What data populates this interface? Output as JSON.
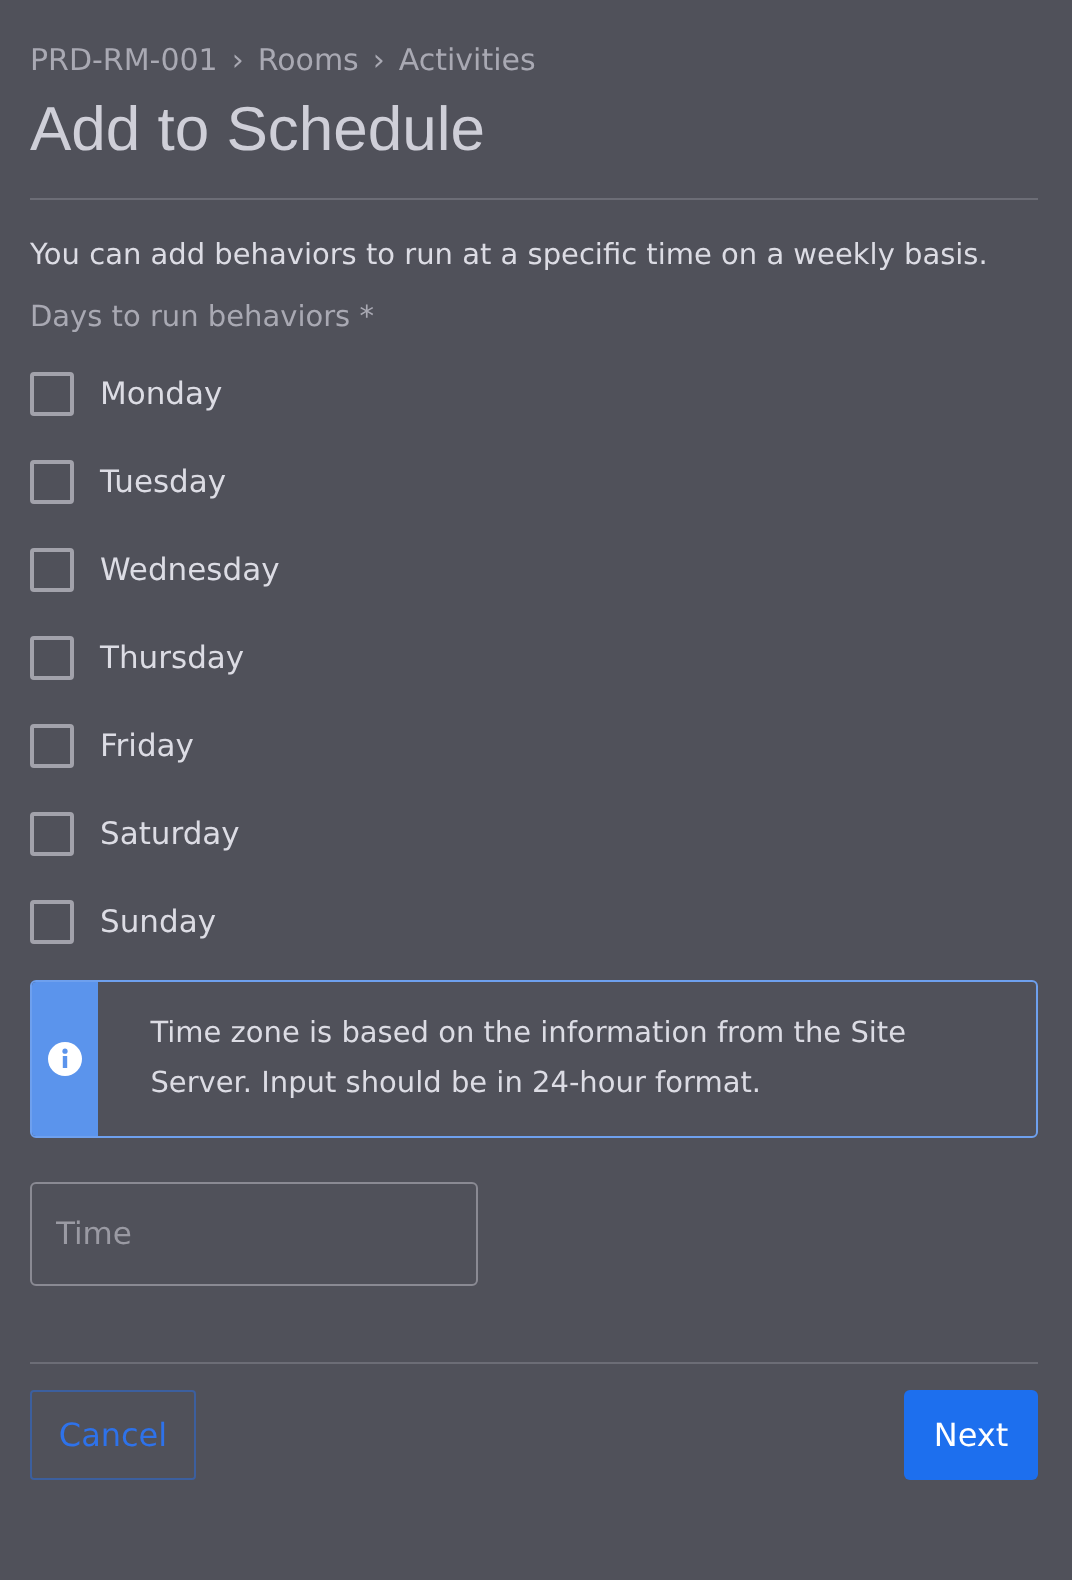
{
  "breadcrumb": {
    "items": [
      "PRD-RM-001",
      "Rooms",
      "Activities"
    ],
    "separator": "›"
  },
  "title": "Add to Schedule",
  "description": "You can add behaviors to run at a specific time on a weekly basis.",
  "days_label": "Days to run behaviors *",
  "days": [
    {
      "label": "Monday",
      "checked": false
    },
    {
      "label": "Tuesday",
      "checked": false
    },
    {
      "label": "Wednesday",
      "checked": false
    },
    {
      "label": "Thursday",
      "checked": false
    },
    {
      "label": "Friday",
      "checked": false
    },
    {
      "label": "Saturday",
      "checked": false
    },
    {
      "label": "Sunday",
      "checked": false
    }
  ],
  "info": {
    "text": "Time zone is based on the information from the Site Server. Input should be in 24-hour format."
  },
  "time_field": {
    "placeholder": "Time"
  },
  "buttons": {
    "cancel": "Cancel",
    "next": "Next"
  }
}
